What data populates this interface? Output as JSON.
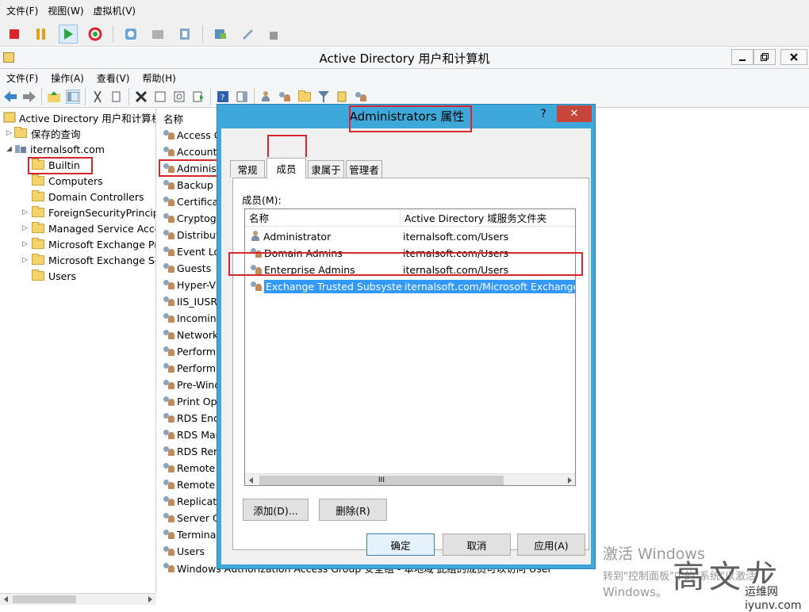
{
  "vm_menu": [
    "文件(F)",
    "视图(W)",
    "虚拟机(V)"
  ],
  "app": {
    "title": "Active Directory 用户和计算机",
    "menu": [
      "文件(F)",
      "操作(A)",
      "查看(V)",
      "帮助(H)"
    ]
  },
  "tree": {
    "root": "Active Directory 用户和计算机",
    "saved_queries": "保存的查询",
    "domain": "iternalsoft.com",
    "items": [
      "Builtin",
      "Computers",
      "Domain Controllers",
      "ForeignSecurityPrincipals",
      "Managed Service Accounts",
      "Microsoft Exchange Pr",
      "Microsoft Exchange Se",
      "Users"
    ]
  },
  "list": {
    "header": "名称",
    "rows": [
      "Access C",
      "Account",
      "Administ",
      "Backup C",
      "Certificat",
      "Cryptogr",
      "Distribut",
      "Event Lo",
      "Guests",
      "Hyper-V",
      "IIS_IUSRS",
      "Incoming",
      "Network",
      "Performa",
      "Performa",
      "Pre-Wind",
      "Print Ope",
      "RDS End",
      "RDS Man",
      "RDS Rem",
      "Remote",
      "Remote",
      "Replicato",
      "Server O",
      "Terminal",
      "Users",
      "Windows Authorization Access Group   安全组 - 本地域   此组的成员可以访问 User"
    ]
  },
  "dialog": {
    "title": "Administrators 属性",
    "help": "?",
    "close": "✕",
    "tabs": [
      "常规",
      "成员",
      "隶属于",
      "管理者"
    ],
    "members_label": "成员(M):",
    "columns": [
      "名称",
      "Active Directory 域服务文件夹"
    ],
    "members": [
      {
        "name": "Administrator",
        "folder": "iternalsoft.com/Users"
      },
      {
        "name": "Domain Admins",
        "folder": "iternalsoft.com/Users"
      },
      {
        "name": "Enterprise Admins",
        "folder": "iternalsoft.com/Users"
      },
      {
        "name": "Exchange Trusted Subsystem",
        "folder": "iternalsoft.com/Microsoft Exchange S"
      }
    ],
    "scroll_thumb": "III",
    "add_button": "添加(D)...",
    "remove_button": "删除(R)",
    "ok_button": "确定",
    "cancel_button": "取消",
    "apply_button": "应用(A)"
  },
  "watermark": {
    "line1": "激活 Windows",
    "line2": "转到\"控制面板\"中的\"系统\"以激活",
    "line3": "Windows。",
    "stamp": "高文龙",
    "site": "运维网 iyunv.com"
  },
  "colors": {
    "accent": "#3fa8db",
    "selection": "#3399ff",
    "highlight_box": "#d9262c"
  }
}
